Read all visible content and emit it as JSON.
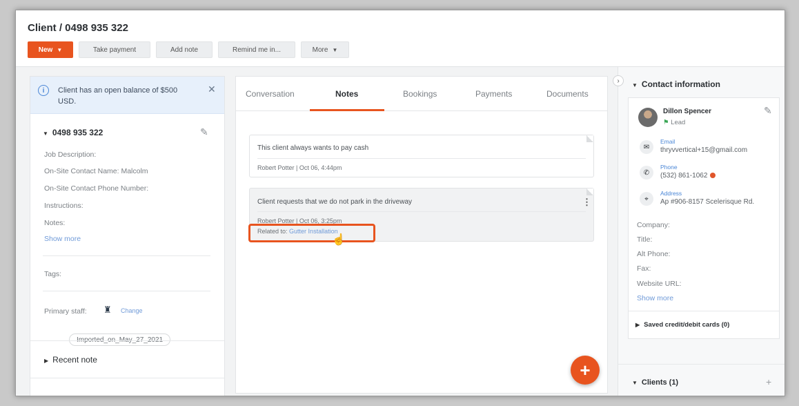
{
  "header": {
    "title": "Client / 0498 935 322",
    "buttons": {
      "new": "New",
      "take_payment": "Take payment",
      "add_note": "Add note",
      "remind_me": "Remind me in...",
      "more": "More"
    }
  },
  "left": {
    "alert_text": "Client has an open balance of $500 USD.",
    "section_title": "0498 935 322",
    "fields": {
      "job_description": "Job Description:",
      "onsite_name": "On-Site Contact Name: Malcolm",
      "onsite_phone": "On-Site Contact Phone Number:",
      "instructions": "Instructions:",
      "notes": "Notes:",
      "show_more": "Show more"
    },
    "tags_label": "Tags:",
    "tag": "Imported_on_May_27_2021",
    "primary_staff_label": "Primary staff:",
    "change_link": "Change",
    "recent_note": "Recent note"
  },
  "tabs": [
    "Conversation",
    "Notes",
    "Bookings",
    "Payments",
    "Documents"
  ],
  "notes": [
    {
      "text": "This client always wants to pay cash",
      "author": "Robert Potter",
      "date": "Oct 06, 4:44pm"
    },
    {
      "text": "Client requests that we do not park in the driveway",
      "author": "Robert Potter",
      "date": "Oct 06, 3:25pm",
      "related_label": "Related to:",
      "related_link": "Gutter Installation"
    }
  ],
  "right": {
    "contact_info_title": "Contact information",
    "name": "Dillon Spencer",
    "status": "Lead",
    "email_label": "Email",
    "email": "thryvvertical+15@gmail.com",
    "phone_label": "Phone",
    "phone": "(532) 861-1062",
    "address_label": "Address",
    "address": "Ap #906-8157 Scelerisque Rd.",
    "fields": {
      "company": "Company:",
      "title": "Title:",
      "alt_phone": "Alt Phone:",
      "fax": "Fax:",
      "website": "Website URL:",
      "show_more": "Show more"
    },
    "saved_cards": "Saved credit/debit cards (0)",
    "clients": "Clients (1)"
  },
  "colors": {
    "accent": "#e8541f",
    "link": "#4a86d6"
  }
}
